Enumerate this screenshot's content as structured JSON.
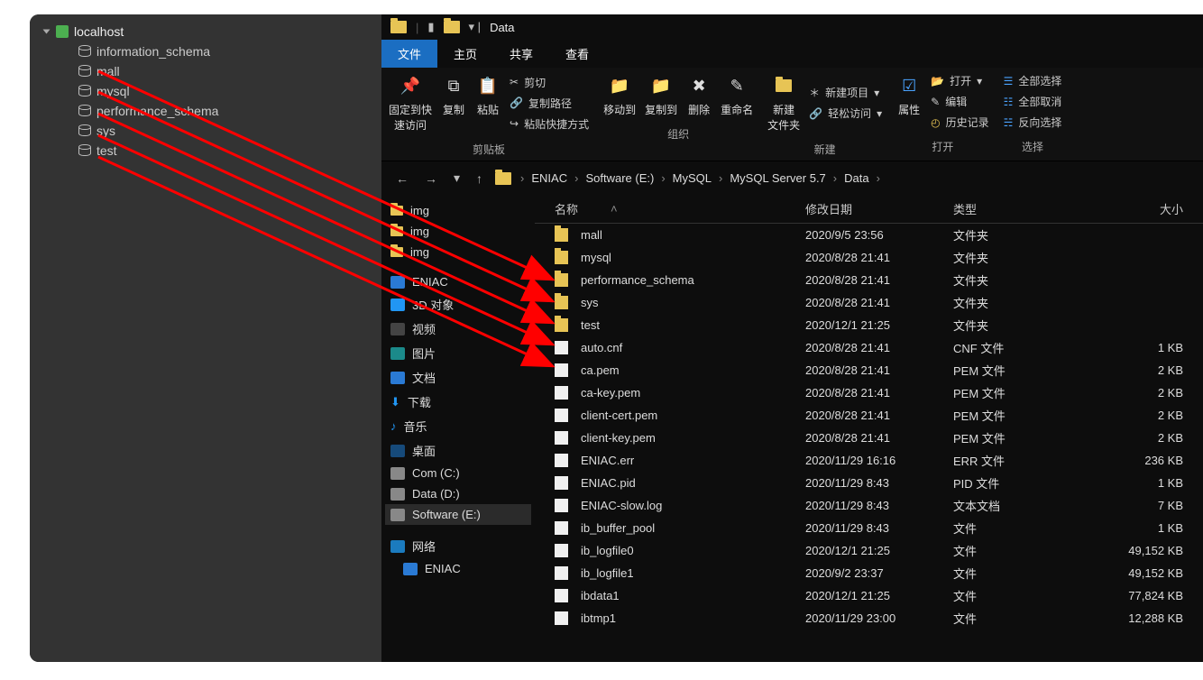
{
  "left": {
    "root": "localhost",
    "dbs": [
      "information_schema",
      "mall",
      "mysql",
      "performance_schema",
      "sys",
      "test"
    ]
  },
  "explorer": {
    "title": "Data",
    "tabs": [
      {
        "label": "文件",
        "active": true
      },
      {
        "label": "主页",
        "active": false
      },
      {
        "label": "共享",
        "active": false
      },
      {
        "label": "查看",
        "active": false
      }
    ],
    "ribbon": {
      "pin": "固定到快\n速访问",
      "copy": "复制",
      "paste": "粘贴",
      "cut": "剪切",
      "copypath": "复制路径",
      "shortcut": "粘贴快捷方式",
      "clip_group": "剪贴板",
      "move": "移动到",
      "copyto": "复制到",
      "delete": "删除",
      "rename": "重命名",
      "org_group": "组织",
      "newfolder": "新建\n文件夹",
      "newitem": "新建项目",
      "easyaccess": "轻松访问",
      "new_group": "新建",
      "properties": "属性",
      "open": "打开",
      "edit": "编辑",
      "history": "历史记录",
      "open_group": "打开",
      "selall": "全部选择",
      "selnone": "全部取消",
      "selinv": "反向选择",
      "sel_group": "选择"
    },
    "breadcrumb": [
      "ENIAC",
      "Software (E:)",
      "MySQL",
      "MySQL Server 5.7",
      "Data"
    ],
    "navtree": {
      "img": "img",
      "eniac": "ENIAC",
      "obj3d": "3D 对象",
      "video": "视频",
      "pictures": "图片",
      "docs": "文档",
      "downloads": "下载",
      "music": "音乐",
      "desktop": "桌面",
      "com": "Com (C:)",
      "datad": "Data (D:)",
      "softe": "Software (E:)",
      "network": "网络",
      "eniac2": "ENIAC"
    },
    "columns": {
      "name": "名称",
      "date": "修改日期",
      "type": "类型",
      "size": "大小"
    },
    "files": [
      {
        "kind": "folder",
        "name": "mall",
        "date": "2020/9/5 23:56",
        "type": "文件夹",
        "size": ""
      },
      {
        "kind": "folder",
        "name": "mysql",
        "date": "2020/8/28 21:41",
        "type": "文件夹",
        "size": ""
      },
      {
        "kind": "folder",
        "name": "performance_schema",
        "date": "2020/8/28 21:41",
        "type": "文件夹",
        "size": ""
      },
      {
        "kind": "folder",
        "name": "sys",
        "date": "2020/8/28 21:41",
        "type": "文件夹",
        "size": ""
      },
      {
        "kind": "folder",
        "name": "test",
        "date": "2020/12/1 21:25",
        "type": "文件夹",
        "size": ""
      },
      {
        "kind": "file",
        "name": "auto.cnf",
        "date": "2020/8/28 21:41",
        "type": "CNF 文件",
        "size": "1 KB"
      },
      {
        "kind": "file",
        "name": "ca.pem",
        "date": "2020/8/28 21:41",
        "type": "PEM 文件",
        "size": "2 KB"
      },
      {
        "kind": "file",
        "name": "ca-key.pem",
        "date": "2020/8/28 21:41",
        "type": "PEM 文件",
        "size": "2 KB"
      },
      {
        "kind": "file",
        "name": "client-cert.pem",
        "date": "2020/8/28 21:41",
        "type": "PEM 文件",
        "size": "2 KB"
      },
      {
        "kind": "file",
        "name": "client-key.pem",
        "date": "2020/8/28 21:41",
        "type": "PEM 文件",
        "size": "2 KB"
      },
      {
        "kind": "file",
        "name": "ENIAC.err",
        "date": "2020/11/29 16:16",
        "type": "ERR 文件",
        "size": "236 KB"
      },
      {
        "kind": "file",
        "name": "ENIAC.pid",
        "date": "2020/11/29 8:43",
        "type": "PID 文件",
        "size": "1 KB"
      },
      {
        "kind": "file",
        "name": "ENIAC-slow.log",
        "date": "2020/11/29 8:43",
        "type": "文本文档",
        "size": "7 KB"
      },
      {
        "kind": "file",
        "name": "ib_buffer_pool",
        "date": "2020/11/29 8:43",
        "type": "文件",
        "size": "1 KB"
      },
      {
        "kind": "file",
        "name": "ib_logfile0",
        "date": "2020/12/1 21:25",
        "type": "文件",
        "size": "49,152 KB"
      },
      {
        "kind": "file",
        "name": "ib_logfile1",
        "date": "2020/9/2 23:37",
        "type": "文件",
        "size": "49,152 KB"
      },
      {
        "kind": "file",
        "name": "ibdata1",
        "date": "2020/12/1 21:25",
        "type": "文件",
        "size": "77,824 KB"
      },
      {
        "kind": "file",
        "name": "ibtmp1",
        "date": "2020/11/29 23:00",
        "type": "文件",
        "size": "12,288 KB"
      }
    ]
  }
}
